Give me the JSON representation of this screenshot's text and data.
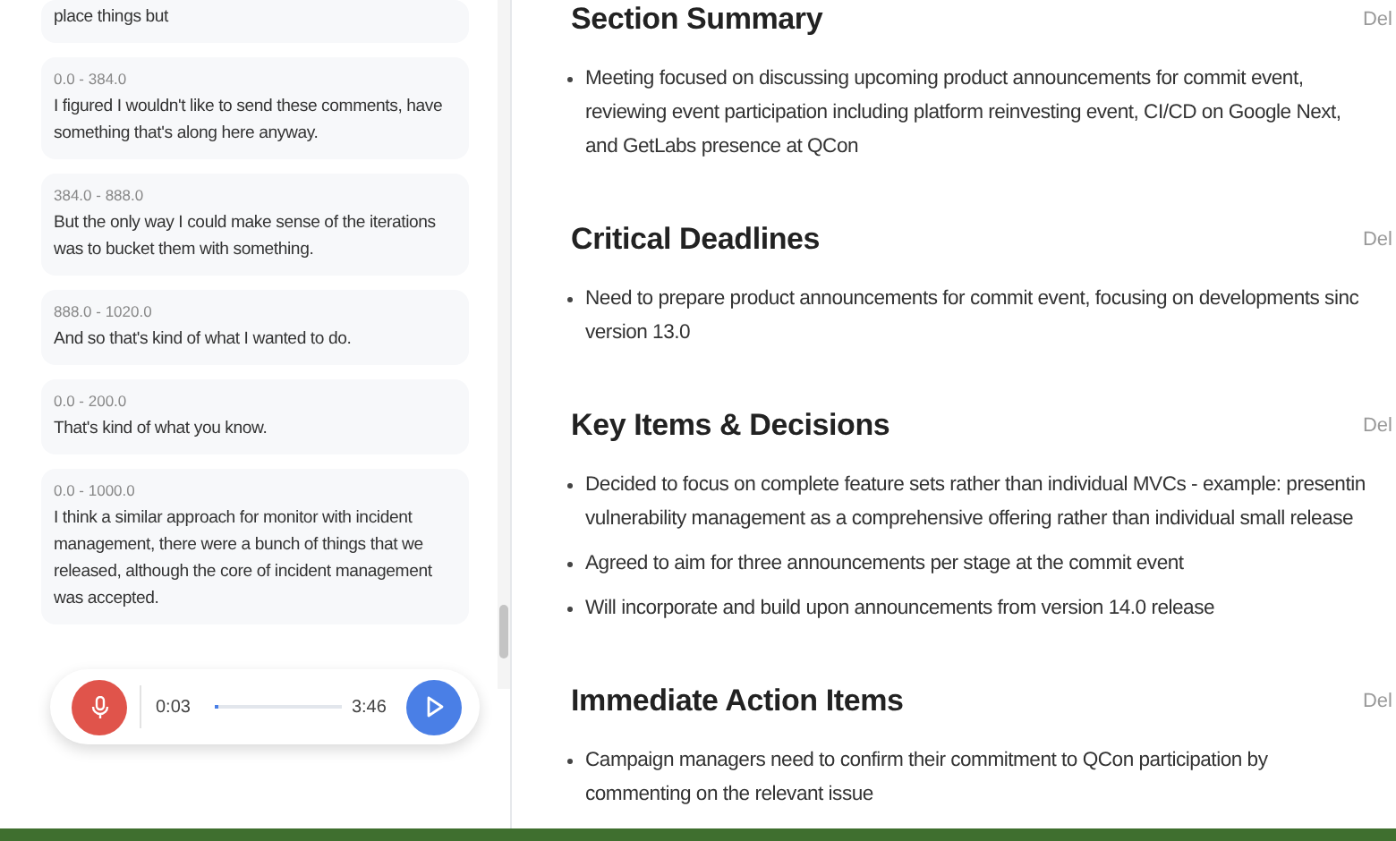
{
  "transcript": [
    {
      "text": "place things but"
    },
    {
      "time": "0.0 - 384.0",
      "text": "I figured I wouldn't like to send these comments, have something that's along here anyway."
    },
    {
      "time": "384.0 - 888.0",
      "text": "But the only way I could make sense of the iterations was to bucket them with something."
    },
    {
      "time": "888.0 - 1020.0",
      "text": "And so that's kind of what I wanted to do."
    },
    {
      "time": "0.0 - 200.0",
      "text": "That's kind of what you know."
    },
    {
      "time": "0.0 - 1000.0",
      "text": "I think a similar approach for monitor with incident management, there were a bunch of things that we released, although the core of incident management was accepted."
    }
  ],
  "player": {
    "elapsed": "0:03",
    "total": "3:46",
    "level": 0.02
  },
  "sections": [
    {
      "title": "Section Summary",
      "action": "Del",
      "bullets": [
        {
          "lines": [
            "Meeting focused on discussing upcoming product announcements for commit event,",
            "reviewing event participation including platform reinvesting event, CI/CD on Google Next,",
            "and GetLabs presence at QCon"
          ]
        }
      ]
    },
    {
      "title": "Critical Deadlines",
      "action": "Del",
      "bullets": [
        {
          "lines": [
            "Need to prepare product announcements for commit event, focusing on developments sinc",
            "version 13.0"
          ]
        }
      ]
    },
    {
      "title": "Key Items & Decisions",
      "action": "Del",
      "bullets": [
        {
          "lines": [
            "Decided to focus on complete feature sets rather than individual MVCs - example: presentin",
            "vulnerability management as a comprehensive offering rather than individual small release"
          ]
        },
        {
          "lines": [
            "Agreed to aim for three announcements per stage at the commit event"
          ]
        },
        {
          "lines": [
            "Will incorporate and build upon announcements from version 14.0 release"
          ]
        }
      ]
    },
    {
      "title": "Immediate Action Items",
      "action": "Del",
      "bullets": [
        {
          "lines": [
            "Campaign managers need to confirm their commitment to QCon participation by",
            "commenting on the relevant issue"
          ]
        }
      ]
    }
  ]
}
